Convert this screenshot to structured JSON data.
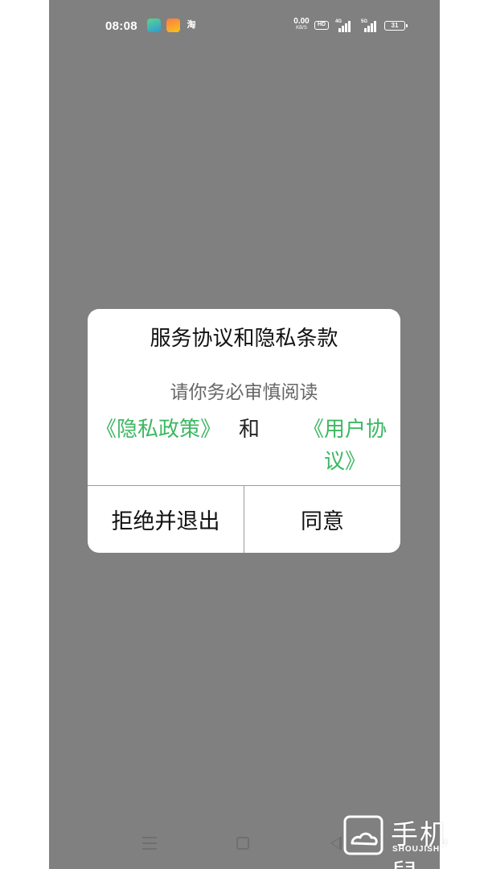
{
  "status_bar": {
    "time": "08:08",
    "notification_icons": [
      "education-app-icon",
      "shopping-app-icon",
      "taobao-icon"
    ],
    "taobao_glyph": "淘",
    "net_speed_value": "0.00",
    "net_speed_unit": "KB/S",
    "hd_label": "HD",
    "signal1_label": "4G",
    "signal2_label": "5G",
    "battery_level": "31"
  },
  "dialog": {
    "title": "服务协议和隐私条款",
    "subtitle": "请你务必审慎阅读",
    "privacy_link": "《隐私政策》",
    "conjunction": "和",
    "user_agreement_link": "《用户协议》",
    "decline_label": "拒绝并退出",
    "agree_label": "同意"
  },
  "colors": {
    "overlay": "#808080",
    "link": "#3cb861",
    "dialog_bg": "#ffffff"
  },
  "watermark": {
    "text": "手机鼠",
    "sub": "SHOUJISHU.COM"
  }
}
